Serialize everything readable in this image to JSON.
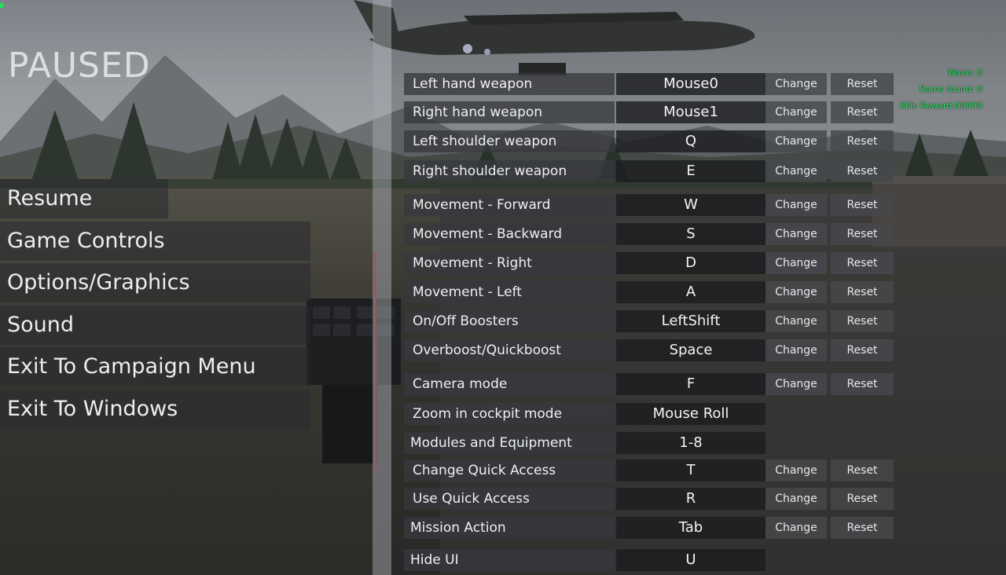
{
  "pause_menu": {
    "title": "PAUSED",
    "items": [
      {
        "label": "Resume"
      },
      {
        "label": "Game Controls"
      },
      {
        "label": "Options/Graphics"
      },
      {
        "label": "Sound"
      },
      {
        "label": "Exit To Campaign Menu"
      },
      {
        "label": "Exit To Windows"
      }
    ]
  },
  "controls": {
    "change_label": "Change",
    "reset_label": "Reset",
    "rows": [
      {
        "action": "Left hand weapon",
        "key": "Mouse0",
        "editable": true
      },
      {
        "action": "Right hand weapon",
        "key": "Mouse1",
        "editable": true
      },
      {
        "action": "Left shoulder weapon",
        "key": "Q",
        "editable": true
      },
      {
        "action": "Right shoulder weapon",
        "key": "E",
        "editable": true
      },
      {
        "action": "Movement - Forward",
        "key": "W",
        "editable": true
      },
      {
        "action": "Movement - Backward",
        "key": "S",
        "editable": true
      },
      {
        "action": "Movement - Right",
        "key": "D",
        "editable": true
      },
      {
        "action": "Movement - Left",
        "key": "A",
        "editable": true
      },
      {
        "action": "On/Off Boosters",
        "key": "LeftShift",
        "editable": true
      },
      {
        "action": "Overboost/Quickboost",
        "key": "Space",
        "editable": true
      },
      {
        "action": "Camera mode",
        "key": "F",
        "editable": true
      },
      {
        "action": "Zoom in cockpit mode",
        "key": "Mouse Roll",
        "editable": false
      },
      {
        "action": "Modules and Equipment",
        "key": "1-8",
        "editable": false
      },
      {
        "action": "Change Quick Access",
        "key": "T",
        "editable": true
      },
      {
        "action": "Use Quick Access",
        "key": "R",
        "editable": true
      },
      {
        "action": "Mission Action",
        "key": "Tab",
        "editable": true
      },
      {
        "action": "Hide UI",
        "key": "U",
        "editable": false
      }
    ]
  },
  "hud": {
    "wave": "Wave: 0",
    "items_found": "Rams found: 0",
    "kills_reward": "Kills Reward:99999"
  },
  "colors": {
    "hud_green": "#22e05a",
    "label_bg": "#37393d",
    "key_bg": "#1c1d20",
    "button_bg": "#46484c"
  }
}
